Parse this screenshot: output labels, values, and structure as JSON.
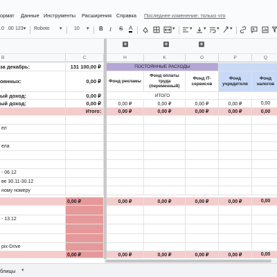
{
  "menu": {
    "items": [
      "ормат",
      "Данные",
      "Инструменты",
      "Расширения",
      "Справка"
    ],
    "last_edit": "Последнее изменение: только что"
  },
  "toolbar": {
    "decimals": ".0",
    "decimals2": ".00",
    "format_more": "123",
    "font": "Roboto",
    "font_size": "10",
    "bold": "B",
    "italic": "I",
    "strike": "S",
    "text_color": "A"
  },
  "columns": {
    "b": "B",
    "c": "C",
    "h": "H",
    "k": "K",
    "o": "O",
    "p": "P",
    "q": "Q"
  },
  "header": {
    "b1": "за декабрь:",
    "c1": "131 100,00 ₽",
    "group_title": "ПОСТОЯННЫЕ РАСХОДЫ",
    "col_h": "Фонд рекламы",
    "col_k": "Фонд оплаты труда (переменный)",
    "col_o": "Фонд IT-сервисов",
    "col_p": "Фонд учредителя",
    "col_q": "Фонд налогов",
    "b2": "оянных:",
    "c2": "0,00 ₽",
    "itogo": "ИТОГО",
    "b3": "ый доход:",
    "c3": "0,00 ₽",
    "b4": "ый доход:",
    "c4": "0,00 ₽",
    "row4_h": "0,00 ₽",
    "row4_k": "0,00 ₽",
    "row4_o": "0,00 ₽",
    "row4_p": "0,00 ₽",
    "row4_q": "0,00"
  },
  "section1": {
    "label": "Итого:",
    "h": "0,00 ₽",
    "k": "0,00 ₽",
    "o": "0,00 ₽",
    "p": "0,00 ₽",
    "q": "0,00"
  },
  "rows1": [
    "",
    "ел",
    "",
    "ела",
    "",
    "",
    "- 06.12",
    "ве 30.11-30.12",
    "ному номеру"
  ],
  "section2": {
    "c": "0,00 ₽",
    "h": "0,00 ₽",
    "k": "0,00 ₽",
    "o": "0,00 ₽",
    "p": "0,00 ₽",
    "q": "0,00"
  },
  "rows2": [
    "- 13.12",
    "",
    "",
    "pix-Drive"
  ],
  "section3": {
    "c": "0,00 ₽",
    "h": "0,00 ₽",
    "k": "0,00 ₽",
    "o": "0,00 ₽",
    "p": "0,00 ₽",
    "q": "0,00"
  },
  "sheet_tab": "блицы",
  "colors": {
    "pink": "#f4cccc",
    "dark_pink": "#e6999a",
    "lavender": "#b4a7d6",
    "light_blue": "#c9daf8"
  }
}
